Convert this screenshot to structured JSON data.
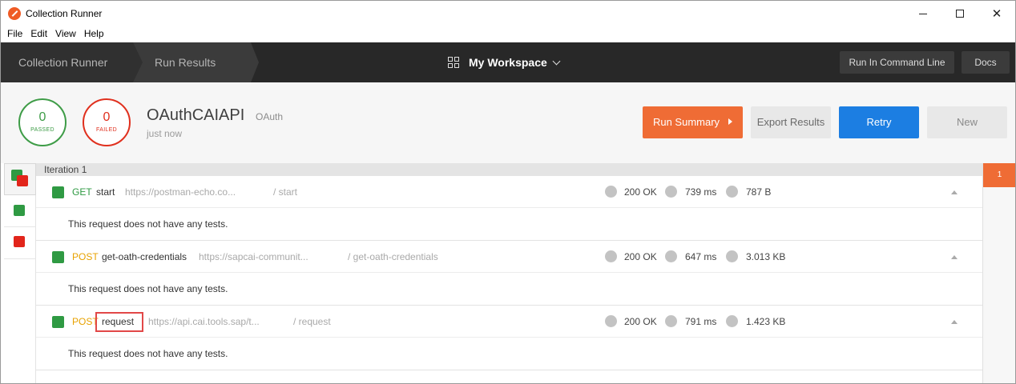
{
  "window": {
    "title": "Collection Runner"
  },
  "menu": [
    "File",
    "Edit",
    "View",
    "Help"
  ],
  "header": {
    "crumbs": [
      "Collection Runner",
      "Run Results"
    ],
    "workspace": "My Workspace",
    "run_cmd": "Run In Command Line",
    "docs": "Docs"
  },
  "summary": {
    "passed": {
      "count": "0",
      "label": "PASSED"
    },
    "failed": {
      "count": "0",
      "label": "FAILED"
    },
    "collection": "OAuthCAIAPI",
    "environment": "OAuth",
    "time": "just now",
    "buttons": {
      "run_summary": "Run Summary",
      "export": "Export Results",
      "retry": "Retry",
      "new": "New"
    }
  },
  "iteration": {
    "label": "Iteration 1",
    "marker": "1"
  },
  "requests": [
    {
      "method": "GET",
      "name": "start",
      "url": "https://postman-echo.co...",
      "path": "/ start",
      "status": "200 OK",
      "time": "739 ms",
      "size": "787 B",
      "note": "This request does not have any tests."
    },
    {
      "method": "POST",
      "name": "get-oath-credentials",
      "url": "https://sapcai-communit...",
      "path": "/ get-oath-credentials",
      "status": "200 OK",
      "time": "647 ms",
      "size": "3.013 KB",
      "note": "This request does not have any tests."
    },
    {
      "method": "POST",
      "name": "request",
      "url": "https://api.cai.tools.sap/t...",
      "path": "/ request",
      "status": "200 OK",
      "time": "791 ms",
      "size": "1.423 KB",
      "note": "This request does not have any tests."
    }
  ],
  "colors": {
    "pass": "#3e9c47",
    "fail": "#e0301e",
    "accent": "#ef6c35",
    "primary": "#1c7ee2",
    "header_bg": "#282828"
  }
}
